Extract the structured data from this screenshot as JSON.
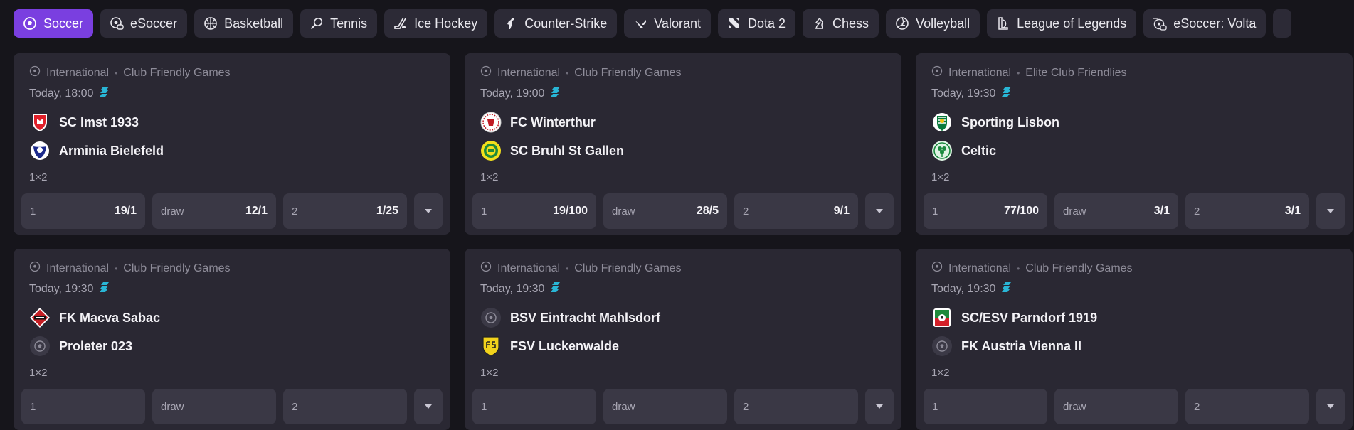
{
  "sports_tabs": [
    {
      "label": "Soccer",
      "icon": "soccer-ball-icon",
      "active": true
    },
    {
      "label": "eSoccer",
      "icon": "esoccer-icon",
      "active": false
    },
    {
      "label": "Basketball",
      "icon": "basketball-icon",
      "active": false
    },
    {
      "label": "Tennis",
      "icon": "tennis-racket-icon",
      "active": false
    },
    {
      "label": "Ice Hockey",
      "icon": "hockey-stick-icon",
      "active": false
    },
    {
      "label": "Counter-Strike",
      "icon": "counter-strike-icon",
      "active": false
    },
    {
      "label": "Valorant",
      "icon": "valorant-icon",
      "active": false
    },
    {
      "label": "Dota 2",
      "icon": "dota-icon",
      "active": false
    },
    {
      "label": "Chess",
      "icon": "chess-knight-icon",
      "active": false
    },
    {
      "label": "Volleyball",
      "icon": "volleyball-icon",
      "active": false
    },
    {
      "label": "League of Legends",
      "icon": "league-of-legends-icon",
      "active": false
    },
    {
      "label": "eSoccer: Volta",
      "icon": "esoccer-volta-icon",
      "active": false
    }
  ],
  "colors": {
    "active_tab": "#7a3fe0",
    "card_bg": "#2a2833",
    "odd_bg": "#3a3845",
    "live_stream_icon": "#29b6d6"
  },
  "matches": [
    {
      "region": "International",
      "league": "Club Friendly Games",
      "time": "Today, 18:00",
      "home": {
        "name": "SC Imst 1933",
        "crest": "red-shield-crest"
      },
      "away": {
        "name": "Arminia Bielefeld",
        "crest": "blue-white-crest"
      },
      "market": "1×2",
      "odds": [
        {
          "label": "1",
          "value": "19/1"
        },
        {
          "label": "draw",
          "value": "12/1"
        },
        {
          "label": "2",
          "value": "1/25"
        }
      ]
    },
    {
      "region": "International",
      "league": "Club Friendly Games",
      "time": "Today, 19:00",
      "home": {
        "name": "FC Winterthur",
        "crest": "red-white-round-crest"
      },
      "away": {
        "name": "SC Bruhl St Gallen",
        "crest": "yellow-green-round-crest"
      },
      "market": "1×2",
      "odds": [
        {
          "label": "1",
          "value": "19/100"
        },
        {
          "label": "draw",
          "value": "28/5"
        },
        {
          "label": "2",
          "value": "9/1"
        }
      ]
    },
    {
      "region": "International",
      "league": "Elite Club Friendlies",
      "time": "Today, 19:30",
      "home": {
        "name": "Sporting Lisbon",
        "crest": "green-lion-crest"
      },
      "away": {
        "name": "Celtic",
        "crest": "green-clover-crest"
      },
      "market": "1×2",
      "odds": [
        {
          "label": "1",
          "value": "77/100"
        },
        {
          "label": "draw",
          "value": "3/1"
        },
        {
          "label": "2",
          "value": "3/1"
        }
      ]
    },
    {
      "region": "International",
      "league": "Club Friendly Games",
      "time": "Today, 19:30",
      "home": {
        "name": "FK Macva Sabac",
        "crest": "red-diamond-crest"
      },
      "away": {
        "name": "Proleter 023",
        "crest": "generic-ball-crest"
      },
      "market": "1×2",
      "odds": [
        {
          "label": "1",
          "value": ""
        },
        {
          "label": "draw",
          "value": ""
        },
        {
          "label": "2",
          "value": ""
        }
      ]
    },
    {
      "region": "International",
      "league": "Club Friendly Games",
      "time": "Today, 19:30",
      "home": {
        "name": "BSV Eintracht Mahlsdorf",
        "crest": "generic-ball-crest"
      },
      "away": {
        "name": "FSV Luckenwalde",
        "crest": "yellow-fsv-crest"
      },
      "market": "1×2",
      "odds": [
        {
          "label": "1",
          "value": ""
        },
        {
          "label": "draw",
          "value": ""
        },
        {
          "label": "2",
          "value": ""
        }
      ]
    },
    {
      "region": "International",
      "league": "Club Friendly Games",
      "time": "Today, 19:30",
      "home": {
        "name": "SC/ESV Parndorf 1919",
        "crest": "green-red-shield-crest"
      },
      "away": {
        "name": "FK Austria Vienna II",
        "crest": "generic-ball-crest"
      },
      "market": "1×2",
      "odds": [
        {
          "label": "1",
          "value": ""
        },
        {
          "label": "draw",
          "value": ""
        },
        {
          "label": "2",
          "value": ""
        }
      ]
    }
  ]
}
